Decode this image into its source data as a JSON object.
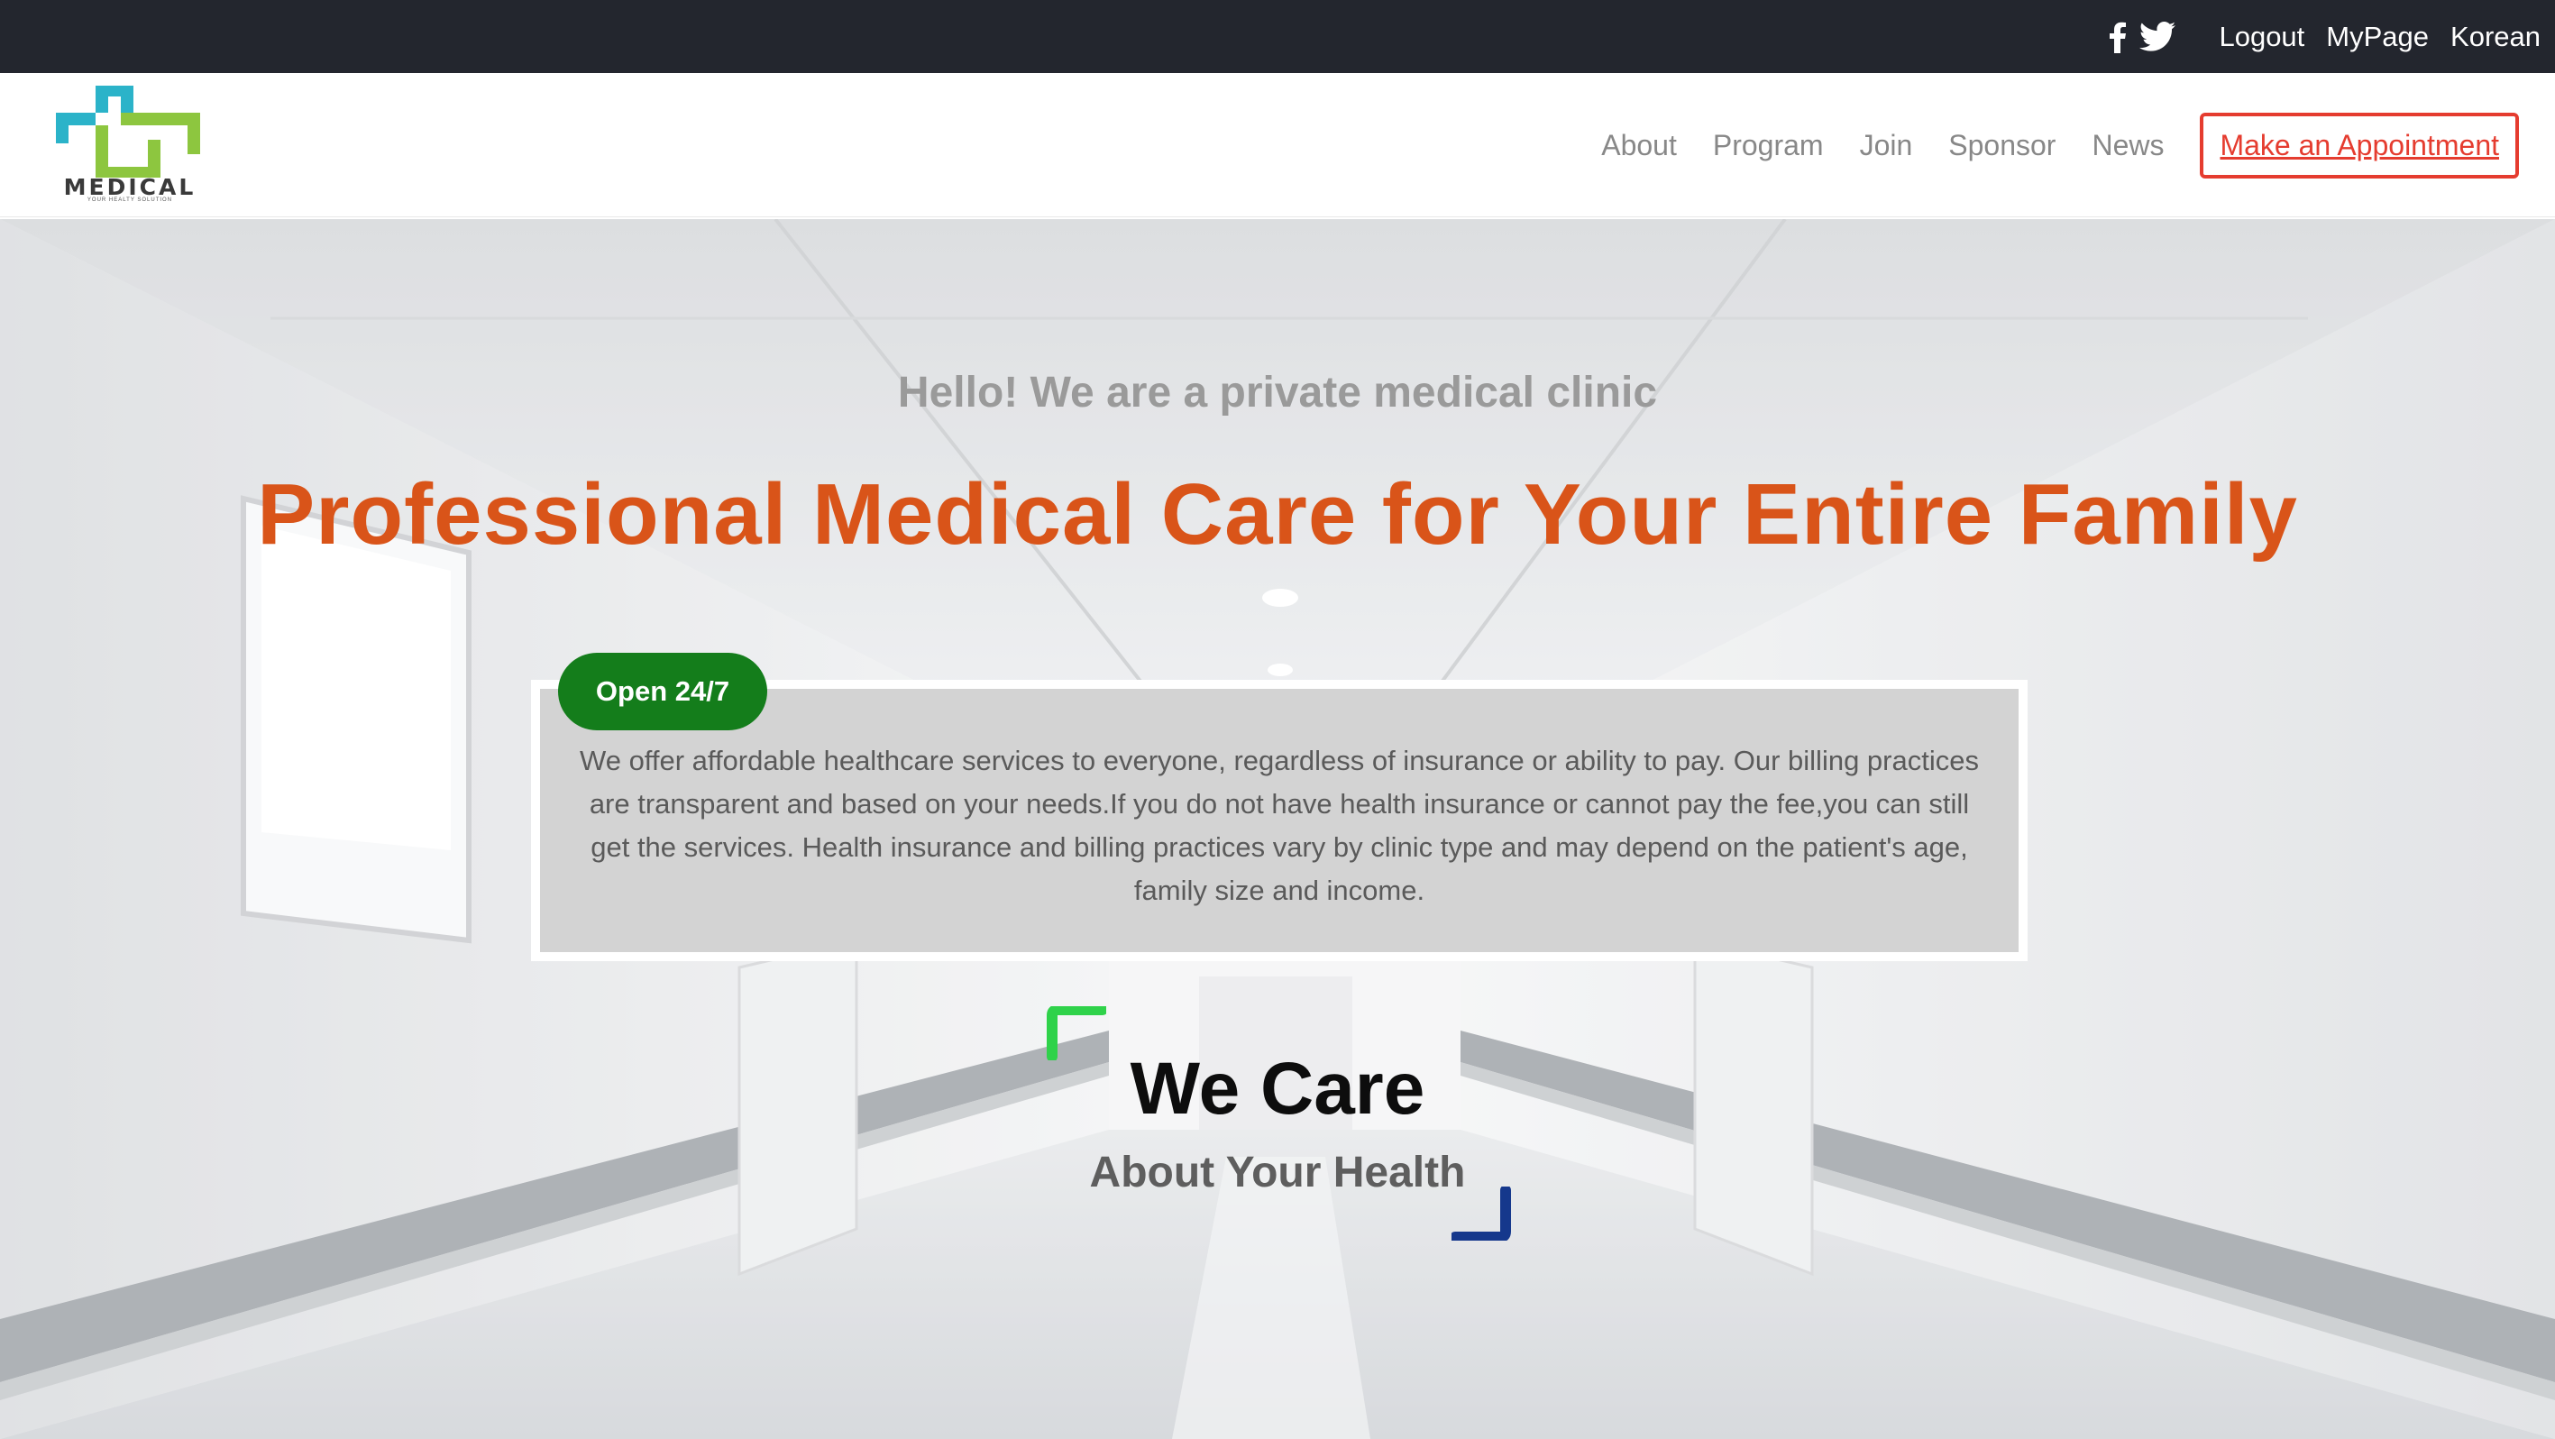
{
  "topbar": {
    "social_icons": [
      "facebook-icon",
      "twitter-icon"
    ],
    "links": [
      "Logout",
      "MyPage",
      "Korean"
    ]
  },
  "header": {
    "logo": {
      "text": "MEDICAL",
      "tagline": "YOUR HEALTY SOLUTION",
      "colors": {
        "cross_blue": "#2bb3c9",
        "cross_green": "#8dc63f"
      }
    },
    "nav": [
      "About",
      "Program",
      "Join",
      "Sponsor",
      "News"
    ],
    "cta_label": "Make an Appointment"
  },
  "hero": {
    "intro": "Hello! We are a private medical clinic",
    "headline": "Professional Medical Care for Your Entire Family",
    "badge": "Open 24/7",
    "description": "We offer affordable healthcare services to everyone, regardless of insurance or ability to pay. Our billing practices are transparent and based on your needs.If you do not have health insurance or cannot pay the fee,you can still get the services. Health insurance and billing practices vary by clinic type and may depend on the patient's age, family size and income.",
    "care_title": "We Care",
    "care_subtitle": "About Your Health"
  },
  "colors": {
    "topbar_bg": "#23262e",
    "accent_red": "#e53c2f",
    "badge_green": "#147d1b",
    "headline_orange": "#d95419",
    "corner_green": "#2fd24a",
    "corner_blue": "#15388c"
  }
}
